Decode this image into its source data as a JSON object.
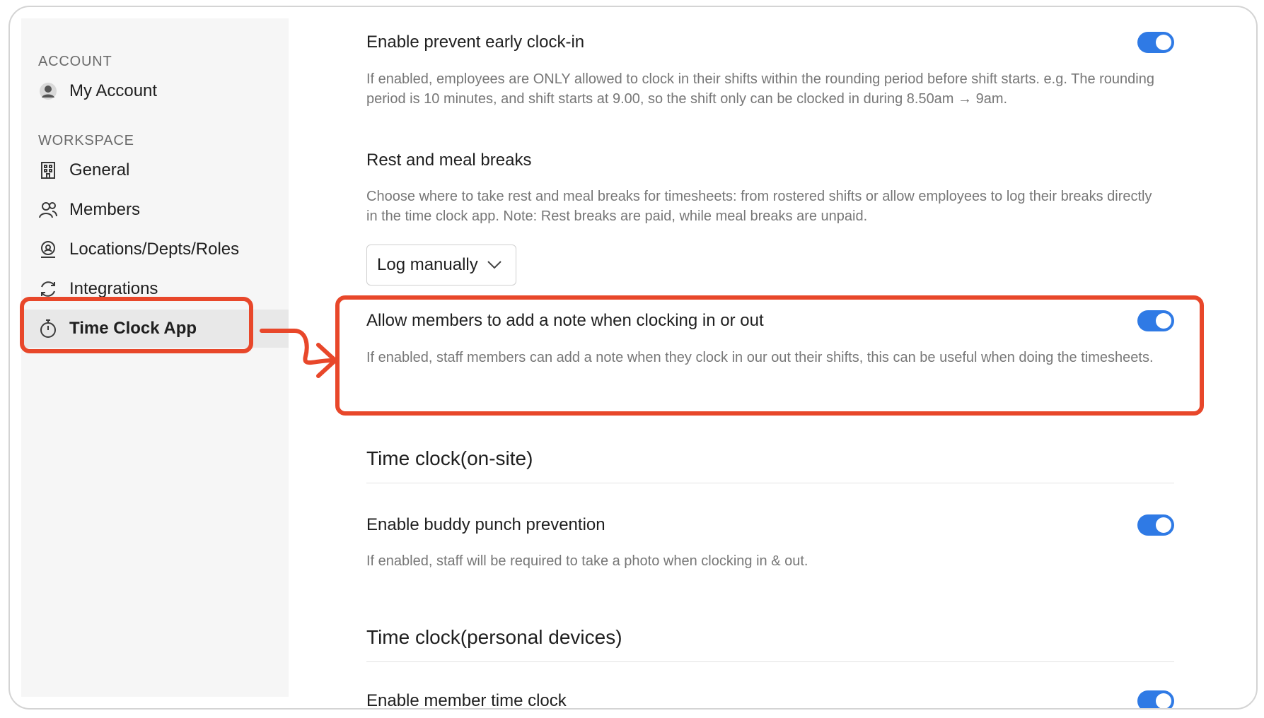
{
  "sidebar": {
    "account_label": "ACCOUNT",
    "workspace_label": "WORKSPACE",
    "account_items": [
      {
        "label": "My Account",
        "icon": "avatar-icon"
      }
    ],
    "workspace_items": [
      {
        "label": "General",
        "icon": "building-icon"
      },
      {
        "label": "Members",
        "icon": "members-icon"
      },
      {
        "label": "Locations/Depts/Roles",
        "icon": "location-pin-icon"
      },
      {
        "label": "Integrations",
        "icon": "sync-icon"
      },
      {
        "label": "Time Clock App",
        "icon": "stopwatch-icon",
        "active": true
      }
    ]
  },
  "settings": {
    "early_clockin": {
      "title": "Enable prevent early clock-in",
      "desc": "If enabled, employees are ONLY allowed to clock in their shifts within the rounding period before shift starts. e.g. The rounding period is 10 minutes, and shift starts at 9.00, so the shift only can be clocked in during 8.50am → 9am.",
      "enabled": true
    },
    "breaks": {
      "title": "Rest and meal breaks",
      "desc": "Choose where to take rest and meal breaks for timesheets: from rostered shifts or allow employees to log their breaks directly in the time clock app. Note: Rest breaks are paid, while meal breaks are unpaid.",
      "select_value": "Log manually"
    },
    "add_note": {
      "title": "Allow members to add a note when clocking in or out",
      "desc": "If enabled, staff members can add a note when they clock in our out their shifts, this can be useful when doing the timesheets.",
      "enabled": true
    },
    "onsite_heading": "Time clock(on-site)",
    "buddy_punch": {
      "title": "Enable buddy punch prevention",
      "desc": "If enabled, staff will be required to take a photo when clocking in & out.",
      "enabled": true
    },
    "personal_heading": "Time clock(personal devices)",
    "member_clock": {
      "title": "Enable member time clock",
      "enabled": true
    }
  },
  "colors": {
    "accent": "#2f7ae5",
    "highlight": "#e8472a"
  }
}
